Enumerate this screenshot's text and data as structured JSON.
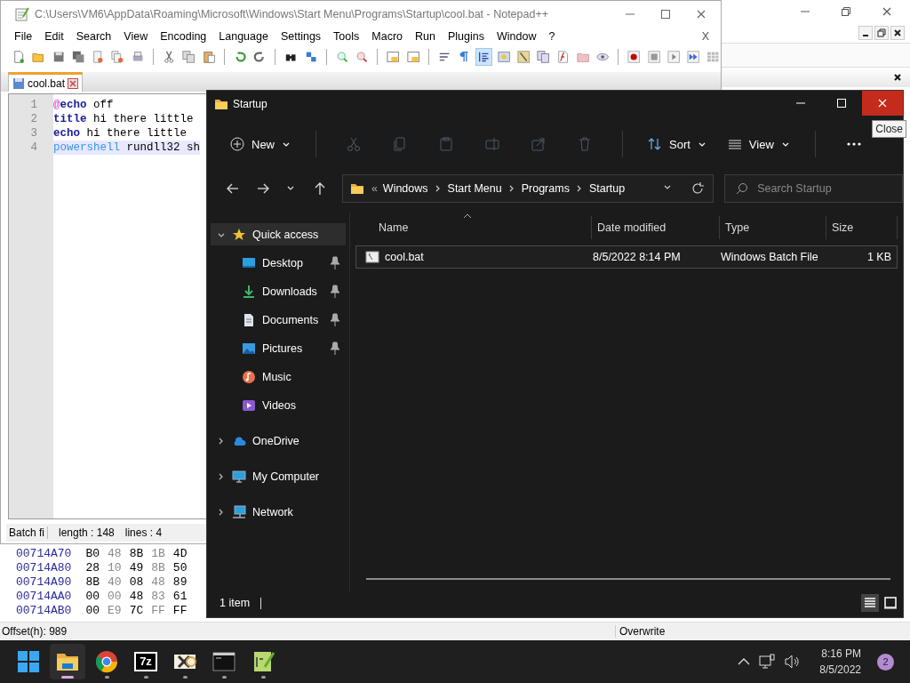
{
  "hex_editor": {
    "rows": [
      {
        "address": "00714A70",
        "bytes": [
          "B0",
          "48",
          "8B",
          "1B",
          "4D"
        ]
      },
      {
        "address": "00714A80",
        "bytes": [
          "28",
          "10",
          "49",
          "8B",
          "50"
        ]
      },
      {
        "address": "00714A90",
        "bytes": [
          "8B",
          "40",
          "08",
          "48",
          "89"
        ]
      },
      {
        "address": "00714AA0",
        "bytes": [
          "00",
          "00",
          "48",
          "83",
          "61"
        ]
      },
      {
        "address": "00714AB0",
        "bytes": [
          "00",
          "E9",
          "7C",
          "FF",
          "FF"
        ]
      }
    ],
    "status_offset": "Offset(h): 989",
    "status_mode": "Overwrite"
  },
  "notepad": {
    "title": "C:\\Users\\VM6\\AppData\\Roaming\\Microsoft\\Windows\\Start Menu\\Programs\\Startup\\cool.bat - Notepad++",
    "menu": [
      "File",
      "Edit",
      "Search",
      "View",
      "Encoding",
      "Language",
      "Settings",
      "Tools",
      "Macro",
      "Run",
      "Plugins",
      "Window",
      "?"
    ],
    "menu_close": "X",
    "indent_guide_on": true,
    "tabs": [
      {
        "label": "cool.bat",
        "selected": true
      }
    ],
    "lines": [
      {
        "number": "1",
        "current": false,
        "tokens": [
          {
            "kind": "symbol",
            "text": "@"
          },
          {
            "kind": "keyword",
            "text": "echo"
          },
          {
            "kind": "plain",
            "text": " off"
          }
        ]
      },
      {
        "number": "2",
        "current": false,
        "tokens": [
          {
            "kind": "keyword",
            "text": "title"
          },
          {
            "kind": "plain",
            "text": " hi there little"
          }
        ]
      },
      {
        "number": "3",
        "current": false,
        "tokens": [
          {
            "kind": "keyword",
            "text": "echo"
          },
          {
            "kind": "plain",
            "text": " hi there little"
          }
        ]
      },
      {
        "number": "4",
        "current": true,
        "tokens": [
          {
            "kind": "external",
            "text": "powershell"
          },
          {
            "kind": "plain",
            "text": " rundll32 sh"
          }
        ]
      }
    ],
    "status": [
      "Batch fi",
      "length : 148",
      "lines : 4"
    ]
  },
  "explorer": {
    "title": "Startup",
    "close_hovered": true,
    "tooltip": "Close",
    "command_bar": {
      "new": "New",
      "sort": "Sort",
      "view": "View",
      "actions_disabled": true
    },
    "address": {
      "overflow": "«",
      "crumbs": [
        "Windows",
        "Start Menu",
        "Programs",
        "Startup"
      ]
    },
    "search": {
      "placeholder": "Search Startup"
    },
    "nav": [
      {
        "kind": "quick",
        "label": "Quick access",
        "expanded": true,
        "selected": true,
        "children": [
          {
            "kind": "desktop",
            "label": "Desktop",
            "pinned": true,
            "selected": false
          },
          {
            "kind": "downloads",
            "label": "Downloads",
            "pinned": true,
            "selected": false
          },
          {
            "kind": "documents",
            "label": "Documents",
            "pinned": true,
            "selected": false
          },
          {
            "kind": "pictures",
            "label": "Pictures",
            "pinned": true,
            "selected": false
          },
          {
            "kind": "music",
            "label": "Music",
            "pinned": false,
            "selected": false
          },
          {
            "kind": "videos",
            "label": "Videos",
            "pinned": false,
            "selected": false
          }
        ]
      },
      {
        "kind": "cloud",
        "label": "OneDrive",
        "expanded": false,
        "selected": false
      },
      {
        "kind": "computer",
        "label": "My Computer",
        "expanded": false,
        "selected": false
      },
      {
        "kind": "network",
        "label": "Network",
        "expanded": false,
        "selected": false
      }
    ],
    "columns": [
      "Name",
      "Date modified",
      "Type",
      "Size"
    ],
    "rows": [
      {
        "name": "cool.bat",
        "date": "8/5/2022 8:14 PM",
        "type": "Windows Batch File",
        "size": "1 KB",
        "selected": true
      }
    ],
    "status": "1 item",
    "views": [
      {
        "kind": "details",
        "selected": true
      },
      {
        "kind": "tiles",
        "selected": false
      }
    ]
  },
  "taskbar": {
    "apps": [
      {
        "kind": "start",
        "running": false,
        "active": false
      },
      {
        "kind": "explorer",
        "running": true,
        "active": true
      },
      {
        "kind": "chrome",
        "running": true,
        "active": false
      },
      {
        "kind": "archiver",
        "label": "7z",
        "running": true,
        "active": false
      },
      {
        "kind": "hex",
        "running": true,
        "active": false
      },
      {
        "kind": "terminal",
        "running": true,
        "active": false
      },
      {
        "kind": "notepad",
        "running": true,
        "active": false
      }
    ],
    "time": "8:16 PM",
    "date": "8/5/2022",
    "notifications": "2"
  }
}
